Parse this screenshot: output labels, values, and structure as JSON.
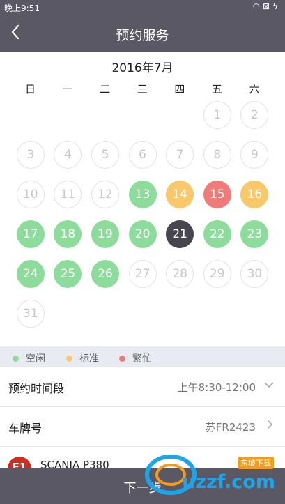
{
  "status_bar": {
    "time": "晚上9:51",
    "icons": [
      "wifi-icon",
      "sim-icon",
      "charging-icon"
    ]
  },
  "header": {
    "title": "预约服务"
  },
  "calendar": {
    "month_label": "2016年7月",
    "weekdays": [
      "日",
      "一",
      "二",
      "三",
      "四",
      "五",
      "六"
    ],
    "first_weekday": 5,
    "days": [
      {
        "d": "1",
        "s": "disabled"
      },
      {
        "d": "2",
        "s": "disabled"
      },
      {
        "d": "3",
        "s": "disabled"
      },
      {
        "d": "4",
        "s": "disabled"
      },
      {
        "d": "5",
        "s": "disabled"
      },
      {
        "d": "6",
        "s": "disabled"
      },
      {
        "d": "7",
        "s": "disabled"
      },
      {
        "d": "8",
        "s": "disabled"
      },
      {
        "d": "9",
        "s": "disabled"
      },
      {
        "d": "10",
        "s": "disabled"
      },
      {
        "d": "11",
        "s": "disabled"
      },
      {
        "d": "12",
        "s": "disabled"
      },
      {
        "d": "13",
        "s": "free"
      },
      {
        "d": "14",
        "s": "std"
      },
      {
        "d": "15",
        "s": "busy"
      },
      {
        "d": "16",
        "s": "std"
      },
      {
        "d": "17",
        "s": "free"
      },
      {
        "d": "18",
        "s": "free"
      },
      {
        "d": "19",
        "s": "free"
      },
      {
        "d": "20",
        "s": "free"
      },
      {
        "d": "21",
        "s": "sel"
      },
      {
        "d": "22",
        "s": "free"
      },
      {
        "d": "23",
        "s": "free"
      },
      {
        "d": "24",
        "s": "free"
      },
      {
        "d": "25",
        "s": "free"
      },
      {
        "d": "26",
        "s": "free"
      },
      {
        "d": "27",
        "s": "disabled"
      },
      {
        "d": "28",
        "s": "disabled"
      },
      {
        "d": "29",
        "s": "disabled"
      },
      {
        "d": "30",
        "s": "disabled"
      },
      {
        "d": "31",
        "s": "disabled"
      }
    ]
  },
  "legend": [
    {
      "label": "空闲",
      "color": "#8edc9c"
    },
    {
      "label": "标准",
      "color": "#f8c86a"
    },
    {
      "label": "繁忙",
      "color": "#f07b7b"
    }
  ],
  "form": {
    "time_slot": {
      "label": "预约时间段",
      "value": "上午8:30-12:00"
    },
    "plate": {
      "label": "车牌号",
      "value": "苏FR2423"
    }
  },
  "vehicle": {
    "logo_text": "F1",
    "name": "SCANIA P380"
  },
  "footer": {
    "next_label": "下一步"
  },
  "watermark": {
    "text": "uzzf.com",
    "badge": "东坡下载"
  }
}
